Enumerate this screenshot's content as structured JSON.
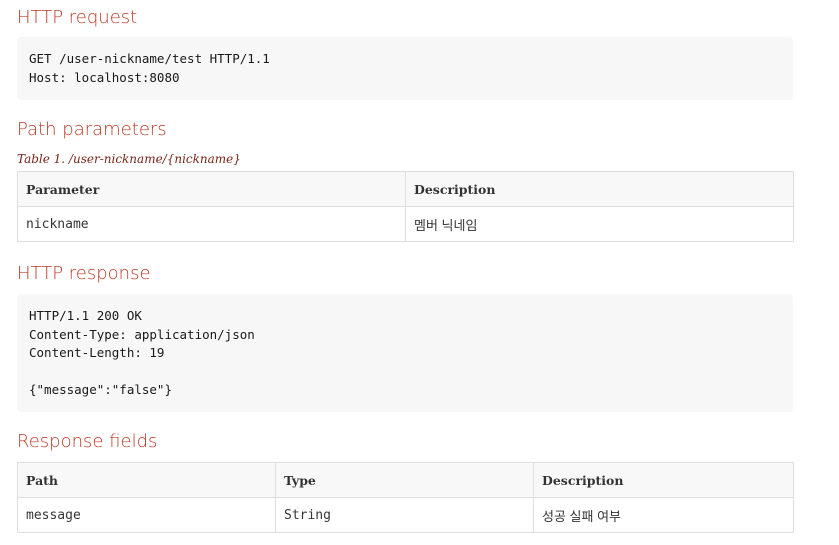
{
  "sections": {
    "request": {
      "title": "HTTP request",
      "code_lines": [
        "GET /user-nickname/test HTTP/1.1",
        "Host: localhost:8080"
      ]
    },
    "path_params": {
      "title": "Path parameters",
      "caption": "Table 1. /user-nickname/{nickname}",
      "headers": [
        "Parameter",
        "Description"
      ],
      "rows": [
        [
          "nickname",
          "멤버 닉네임"
        ]
      ]
    },
    "response": {
      "title": "HTTP response",
      "code_lines": [
        "HTTP/1.1 200 OK",
        "Content-Type: application/json",
        "Content-Length: 19",
        "",
        "{\"message\":\"false\"}"
      ]
    },
    "response_fields": {
      "title": "Response fields",
      "headers": [
        "Path",
        "Type",
        "Description"
      ],
      "rows": [
        [
          "message",
          "String",
          "성공 실패 여부"
        ]
      ]
    }
  }
}
